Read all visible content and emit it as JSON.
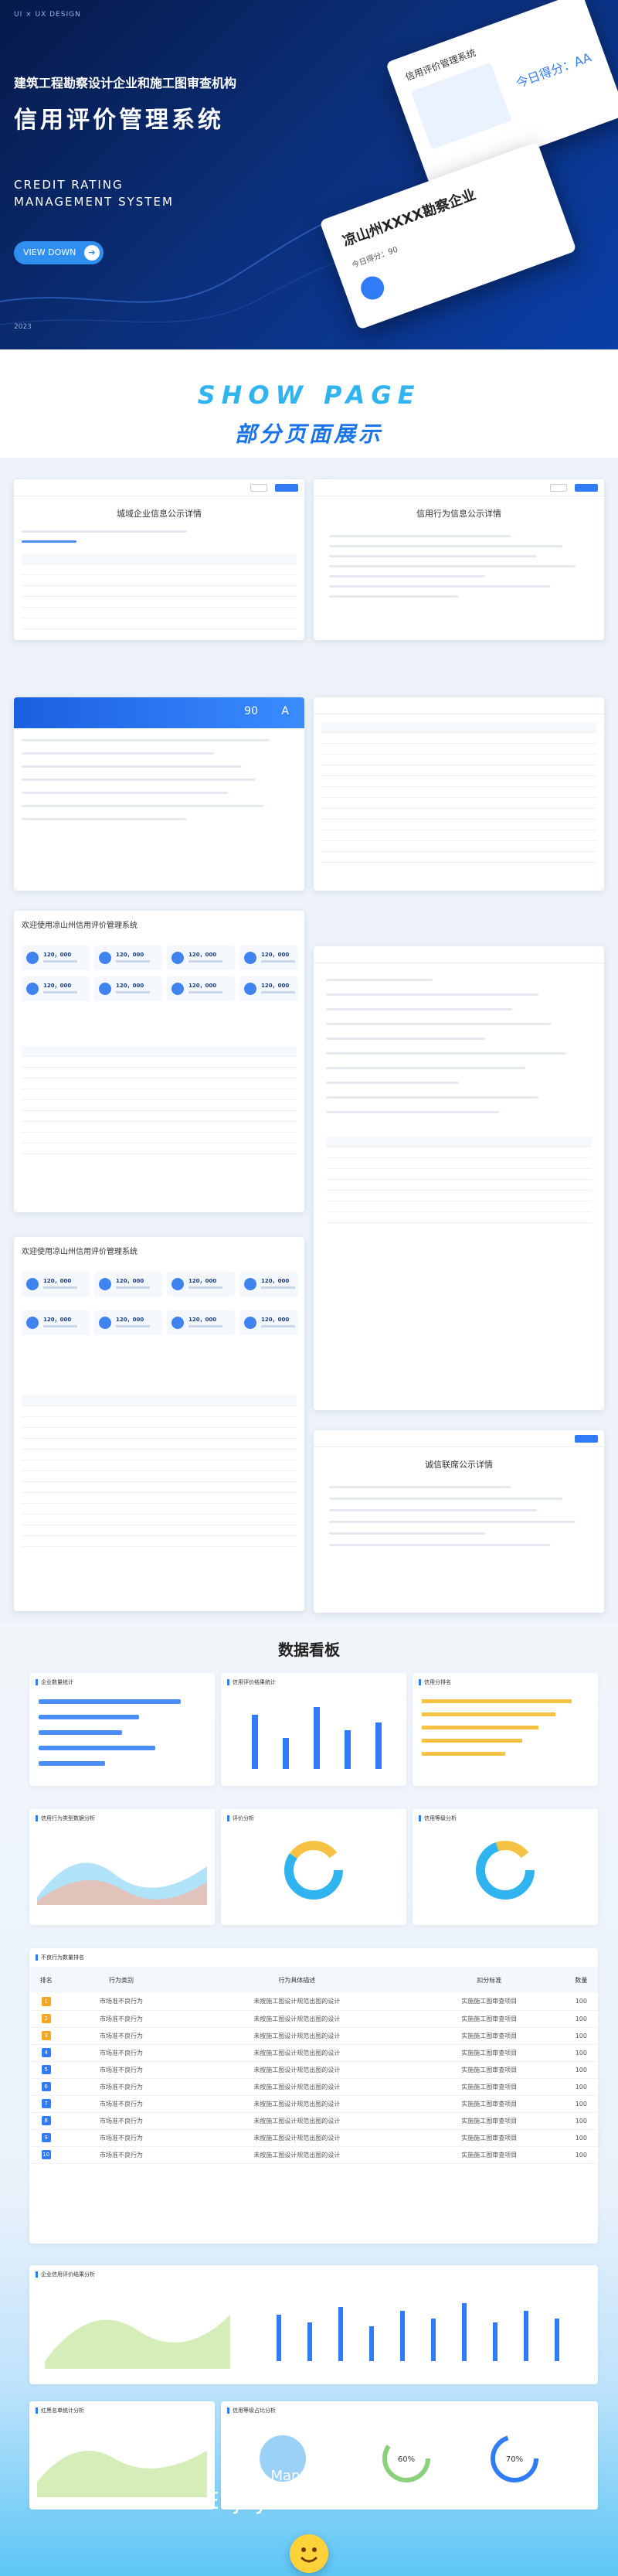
{
  "hero": {
    "tag": "UI  ×  UX  DESIGN",
    "subtitle": "建筑工程勘察设计企业和施工图审查机构",
    "title": "信用评价管理系统",
    "en_title": "CREDIT RATING\nMANAGEMENT SYSTEM",
    "button": "VIEW DOWN",
    "year": "2023",
    "mock_title": "信用评价管理系统",
    "mock_org": "凉山州XXXX勘察企业",
    "mock_score_label": "今日得分：90",
    "mock_grade": "今日得分：AA"
  },
  "show": {
    "title_en": "SHOW PAGE",
    "title_cn": "部分页面展示"
  },
  "shots": {
    "s1_title": "城域企业信息公示详情",
    "s2_title": "信用行为信息公示详情",
    "s3_score": "90",
    "s3_grade": "A",
    "s5_title": "欢迎使用凉山州信用评价管理系统",
    "s7_title": "欢迎使用凉山州信用评价管理系统",
    "s8_title": "诚信联席公示详情",
    "stat_value": "120，000"
  },
  "dash": {
    "title": "数据看板",
    "p1": "企业数量统计",
    "p2": "信用评价结果统计",
    "p3": "信用分排名",
    "p4": "信用行为类型数据分析",
    "p5": "评价分析",
    "p6": "信用等级分析",
    "p7": "不良行为数量排名",
    "p8": "企业信用评价结果分析",
    "p9": "红黑名单统计分析",
    "p10": "信用等级占比分析",
    "table_headers": [
      "排名",
      "行为类别",
      "行为具体描述",
      "扣分标准",
      "数量"
    ],
    "rows": [
      [
        "1",
        "市场准不良行为",
        "未按施工图设计规范出图的设计",
        "实施施工图审查项目",
        "100"
      ],
      [
        "2",
        "市场准不良行为",
        "未按施工图设计规范出图的设计",
        "实施施工图审查项目",
        "100"
      ],
      [
        "3",
        "市场准不良行为",
        "未按施工图设计规范出图的设计",
        "实施施工图审查项目",
        "100"
      ],
      [
        "4",
        "市场准不良行为",
        "未按施工图设计规范出图的设计",
        "实施施工图审查项目",
        "100"
      ],
      [
        "5",
        "市场准不良行为",
        "未按施工图设计规范出图的设计",
        "实施施工图审查项目",
        "100"
      ],
      [
        "6",
        "市场准不良行为",
        "未按施工图设计规范出图的设计",
        "实施施工图审查项目",
        "100"
      ],
      [
        "7",
        "市场准不良行为",
        "未按施工图设计规范出图的设计",
        "实施施工图审查项目",
        "100"
      ],
      [
        "8",
        "市场准不良行为",
        "未按施工图设计规范出图的设计",
        "实施施工图审查项目",
        "100"
      ],
      [
        "9",
        "市场准不良行为",
        "未按施工图设计规范出图的设计",
        "实施施工图审查项目",
        "100"
      ],
      [
        "10",
        "市场准不良行为",
        "未按施工图设计规范出图的设计",
        "实施施工图审查项目",
        "100"
      ]
    ],
    "rank_colors": [
      "#f5a623",
      "#f5a623",
      "#f5a623",
      "#2f7cf6",
      "#2f7cf6",
      "#2f7cf6",
      "#2f7cf6",
      "#2f7cf6",
      "#2f7cf6",
      "#2f7cf6"
    ],
    "donut1_pct": "60%",
    "donut2_pct": "70%"
  },
  "footer": {
    "many": "Many More",
    "enjoy": "Enjoy Our Product"
  },
  "colors": {
    "accent": "#2f7cf6",
    "hero": "#0b2e77",
    "cyan": "#2fb4f0"
  }
}
